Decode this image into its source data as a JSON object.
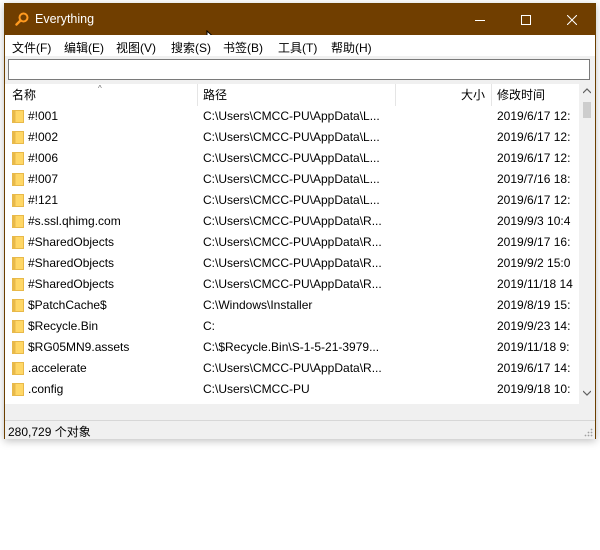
{
  "window": {
    "title": "Everything",
    "controls": {
      "minimize": "minimize",
      "maximize": "maximize",
      "close": "close"
    }
  },
  "menu": [
    "文件(F)",
    "编辑(E)",
    "视图(V)",
    "搜索(S)",
    "书签(B)",
    "工具(T)",
    "帮助(H)"
  ],
  "search": {
    "value": "",
    "placeholder": ""
  },
  "columns": {
    "name": "名称",
    "path": "路径",
    "size": "大小",
    "modified": "修改时间"
  },
  "rows": [
    {
      "name": "#!001",
      "path": "C:\\Users\\CMCC-PU\\AppData\\L...",
      "size": "",
      "modified": "2019/6/17 12:"
    },
    {
      "name": "#!002",
      "path": "C:\\Users\\CMCC-PU\\AppData\\L...",
      "size": "",
      "modified": "2019/6/17 12:"
    },
    {
      "name": "#!006",
      "path": "C:\\Users\\CMCC-PU\\AppData\\L...",
      "size": "",
      "modified": "2019/6/17 12:"
    },
    {
      "name": "#!007",
      "path": "C:\\Users\\CMCC-PU\\AppData\\L...",
      "size": "",
      "modified": "2019/7/16 18:"
    },
    {
      "name": "#!121",
      "path": "C:\\Users\\CMCC-PU\\AppData\\L...",
      "size": "",
      "modified": "2019/6/17 12:"
    },
    {
      "name": "#s.ssl.qhimg.com",
      "path": "C:\\Users\\CMCC-PU\\AppData\\R...",
      "size": "",
      "modified": "2019/9/3 10:4"
    },
    {
      "name": "#SharedObjects",
      "path": "C:\\Users\\CMCC-PU\\AppData\\R...",
      "size": "",
      "modified": "2019/9/17 16:"
    },
    {
      "name": "#SharedObjects",
      "path": "C:\\Users\\CMCC-PU\\AppData\\R...",
      "size": "",
      "modified": "2019/9/2 15:0"
    },
    {
      "name": "#SharedObjects",
      "path": "C:\\Users\\CMCC-PU\\AppData\\R...",
      "size": "",
      "modified": "2019/11/18 14"
    },
    {
      "name": "$PatchCache$",
      "path": "C:\\Windows\\Installer",
      "size": "",
      "modified": "2019/8/19 15:"
    },
    {
      "name": "$Recycle.Bin",
      "path": "C:",
      "size": "",
      "modified": "2019/9/23 14:"
    },
    {
      "name": "$RG05MN9.assets",
      "path": "C:\\$Recycle.Bin\\S-1-5-21-3979...",
      "size": "",
      "modified": "2019/11/18 9:"
    },
    {
      "name": ".accelerate",
      "path": "C:\\Users\\CMCC-PU\\AppData\\R...",
      "size": "",
      "modified": "2019/6/17 14:"
    },
    {
      "name": ".config",
      "path": "C:\\Users\\CMCC-PU",
      "size": "",
      "modified": "2019/9/18 10:"
    }
  ],
  "status": {
    "count_text": "280,729 个对象"
  },
  "colors": {
    "titlebar": "#703e00",
    "folder": "#ffd766",
    "folder_dark": "#e8b94a",
    "scrollbar_thumb": "#cdcdcd"
  },
  "icons": {
    "app": "search-magnifier-icon",
    "folder": "folder-icon"
  },
  "scroll": {
    "vertical_position": 0.0,
    "horizontal_visible_fraction": 0.87
  }
}
